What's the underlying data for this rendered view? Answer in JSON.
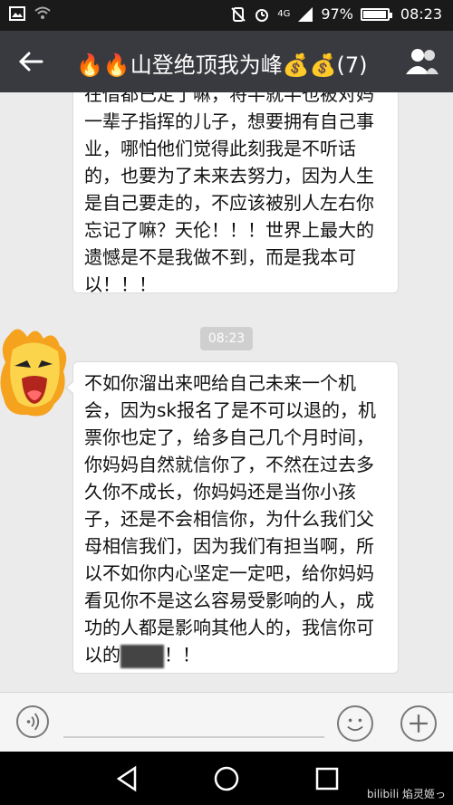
{
  "status_bar": {
    "network_label": "4G",
    "battery_text": "97%",
    "battery_level": 0.97,
    "time": "08:23"
  },
  "header": {
    "title": "🔥🔥山登绝顶我为峰💰💰(7)"
  },
  "messages": [
    {
      "text": "在借都已定了嘛，将半就半也被对妈一辈子指挥的儿子，想要拥有自己事业，哪怕他们觉得此刻我是不听话的，也要为了未来去努力，因为人生是自己要走的，不应该被别人左右你忘记了嘛？天伦！！！世界上最大的遗憾是不是我做不到，而是我本可以！！！"
    },
    {
      "text_before": "不如你溜出来吧给自己未来一个机会，因为sk报名了是不可以退的，机票你也定了，给多自己几个月时间，你妈妈自然就信你了，不然在过去多久你不成长，你妈妈还是当你小孩子，还是不会相信你，为什么我们父母相信我们，因为我们有担当啊，所以不如你内心坚定一定吧，给你妈妈看见你不是这么容易受影响的人，成功的人都是影响其他人的，我信你可以的",
      "text_after": "！！"
    }
  ],
  "timestamp": "08:23",
  "input_bar": {
    "placeholder": ""
  },
  "watermark": "bilibili 焰灵姬っ",
  "colors": {
    "header_bg": "#393a3f",
    "chat_bg": "#ebebeb",
    "bubble_bg": "#ffffff"
  },
  "icons": [
    "photo-icon",
    "wifi-icon",
    "silent-icon",
    "alarm-icon",
    "signal-icon",
    "battery-icon",
    "back-arrow-icon",
    "group-members-icon",
    "voice-icon",
    "emoji-icon",
    "plus-icon",
    "nav-back-icon",
    "nav-home-icon",
    "nav-recents-icon"
  ]
}
